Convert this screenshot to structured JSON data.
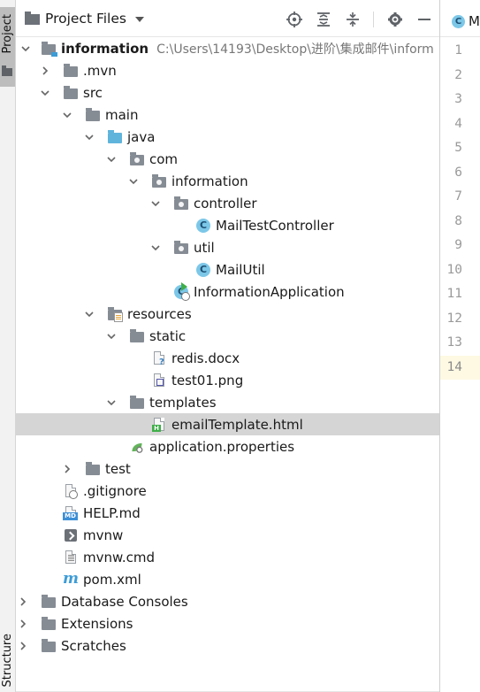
{
  "sidebar": {
    "project_tab": "Project",
    "structure_tab": "Structure"
  },
  "header": {
    "title": "Project Files",
    "tools": [
      "locate-icon",
      "expand-all-icon",
      "collapse-all-icon",
      "settings-icon",
      "minimize-icon"
    ]
  },
  "tree": {
    "root": {
      "label": "information",
      "path": "C:\\Users\\14193\\Desktop\\进阶\\集成邮件\\inform"
    },
    "items": [
      {
        "label": ".mvn"
      },
      {
        "label": "src"
      },
      {
        "label": "main"
      },
      {
        "label": "java"
      },
      {
        "label": "com"
      },
      {
        "label": "information"
      },
      {
        "label": "controller"
      },
      {
        "label": "MailTestController"
      },
      {
        "label": "util"
      },
      {
        "label": "MailUtil"
      },
      {
        "label": "InformationApplication"
      },
      {
        "label": "resources"
      },
      {
        "label": "static"
      },
      {
        "label": "redis.docx"
      },
      {
        "label": "test01.png"
      },
      {
        "label": "templates"
      },
      {
        "label": "emailTemplate.html"
      },
      {
        "label": "application.properties"
      },
      {
        "label": "test"
      },
      {
        "label": ".gitignore"
      },
      {
        "label": "HELP.md"
      },
      {
        "label": "mvnw"
      },
      {
        "label": "mvnw.cmd"
      },
      {
        "label": "pom.xml"
      },
      {
        "label": "Database Consoles"
      },
      {
        "label": "Extensions"
      },
      {
        "label": "Scratches"
      }
    ],
    "selected": "emailTemplate.html"
  },
  "editor": {
    "tab_icon_letter": "C",
    "tab_label": "M",
    "line_numbers": [
      "1",
      "2",
      "3",
      "4",
      "5",
      "6",
      "7",
      "8",
      "9",
      "10",
      "11",
      "12",
      "13",
      "14"
    ],
    "current_line": "14"
  },
  "icons": {
    "class_letter": "C",
    "md_badge": "MD",
    "html_badge": "H",
    "maven_glyph": "m"
  }
}
